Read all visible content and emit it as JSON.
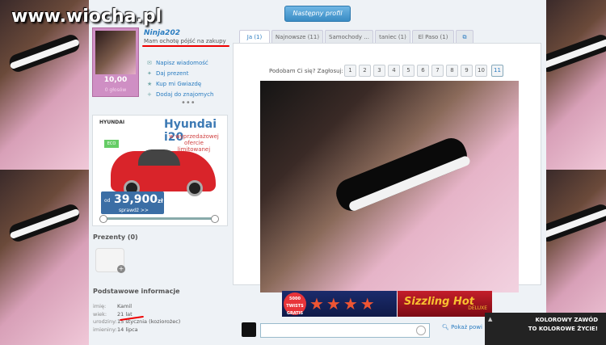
{
  "watermark": "www.wiocha.pl",
  "header": {
    "next_profile": "Następny profil"
  },
  "profile": {
    "username": "Ninja202",
    "status": "Mam ochotę pójść na zakupy",
    "score": "10,00",
    "score_sub": "0 głosów",
    "actions": [
      {
        "icon": "mail-icon",
        "glyph": "✉",
        "label": "Napisz wiadomość"
      },
      {
        "icon": "gift-icon",
        "glyph": "✦",
        "label": "Daj prezent"
      },
      {
        "icon": "star-icon",
        "glyph": "★",
        "label": "Kup mi Gwiazdę"
      },
      {
        "icon": "user-add-icon",
        "glyph": "+",
        "label": "Dodaj do znajomych"
      }
    ],
    "more": "•••"
  },
  "ad": {
    "brand": "HYUNDAI",
    "model": "Hyundai i20",
    "promo": "w wyprzedażowej ofercie limitowanej",
    "lpg": "ECO LPG",
    "od": "od",
    "price": "39,900",
    "currency": "zł",
    "check": "sprawdź >>"
  },
  "gifts": {
    "title": "Prezenty (0)"
  },
  "basic_info": {
    "title": "Podstawowe informacje",
    "rows": [
      {
        "k": "imię:",
        "v": "Kamil"
      },
      {
        "k": "wiek:",
        "v": "21 lat"
      },
      {
        "k": "urodziny:",
        "v": "15 stycznia (koziorożec)"
      },
      {
        "k": "imieniny:",
        "v": "14 lipca"
      }
    ]
  },
  "tabs": [
    {
      "label": "Ja (1)",
      "active": true
    },
    {
      "label": "Najnowsze (11)"
    },
    {
      "label": "Samochody ..."
    },
    {
      "label": "taniec (1)"
    },
    {
      "label": "El Paso (1)"
    },
    {
      "label": "⧉"
    }
  ],
  "vote": {
    "label": "Podobam Ci się? Zagłosuj:",
    "options": [
      "1",
      "2",
      "3",
      "4",
      "5",
      "6",
      "7",
      "8",
      "9",
      "10",
      "11"
    ]
  },
  "banner": {
    "badge": "5000 TWISTS GRATIS",
    "game": "Sizzling Hot",
    "edition": "DELUXE"
  },
  "comment": {
    "show_link": "Pokaż powi"
  },
  "popup": {
    "line1": "KOLOROWY ZAWÓD",
    "line2": "TO KOLOROWE ŻYCIE!",
    "arrow": "▲"
  }
}
